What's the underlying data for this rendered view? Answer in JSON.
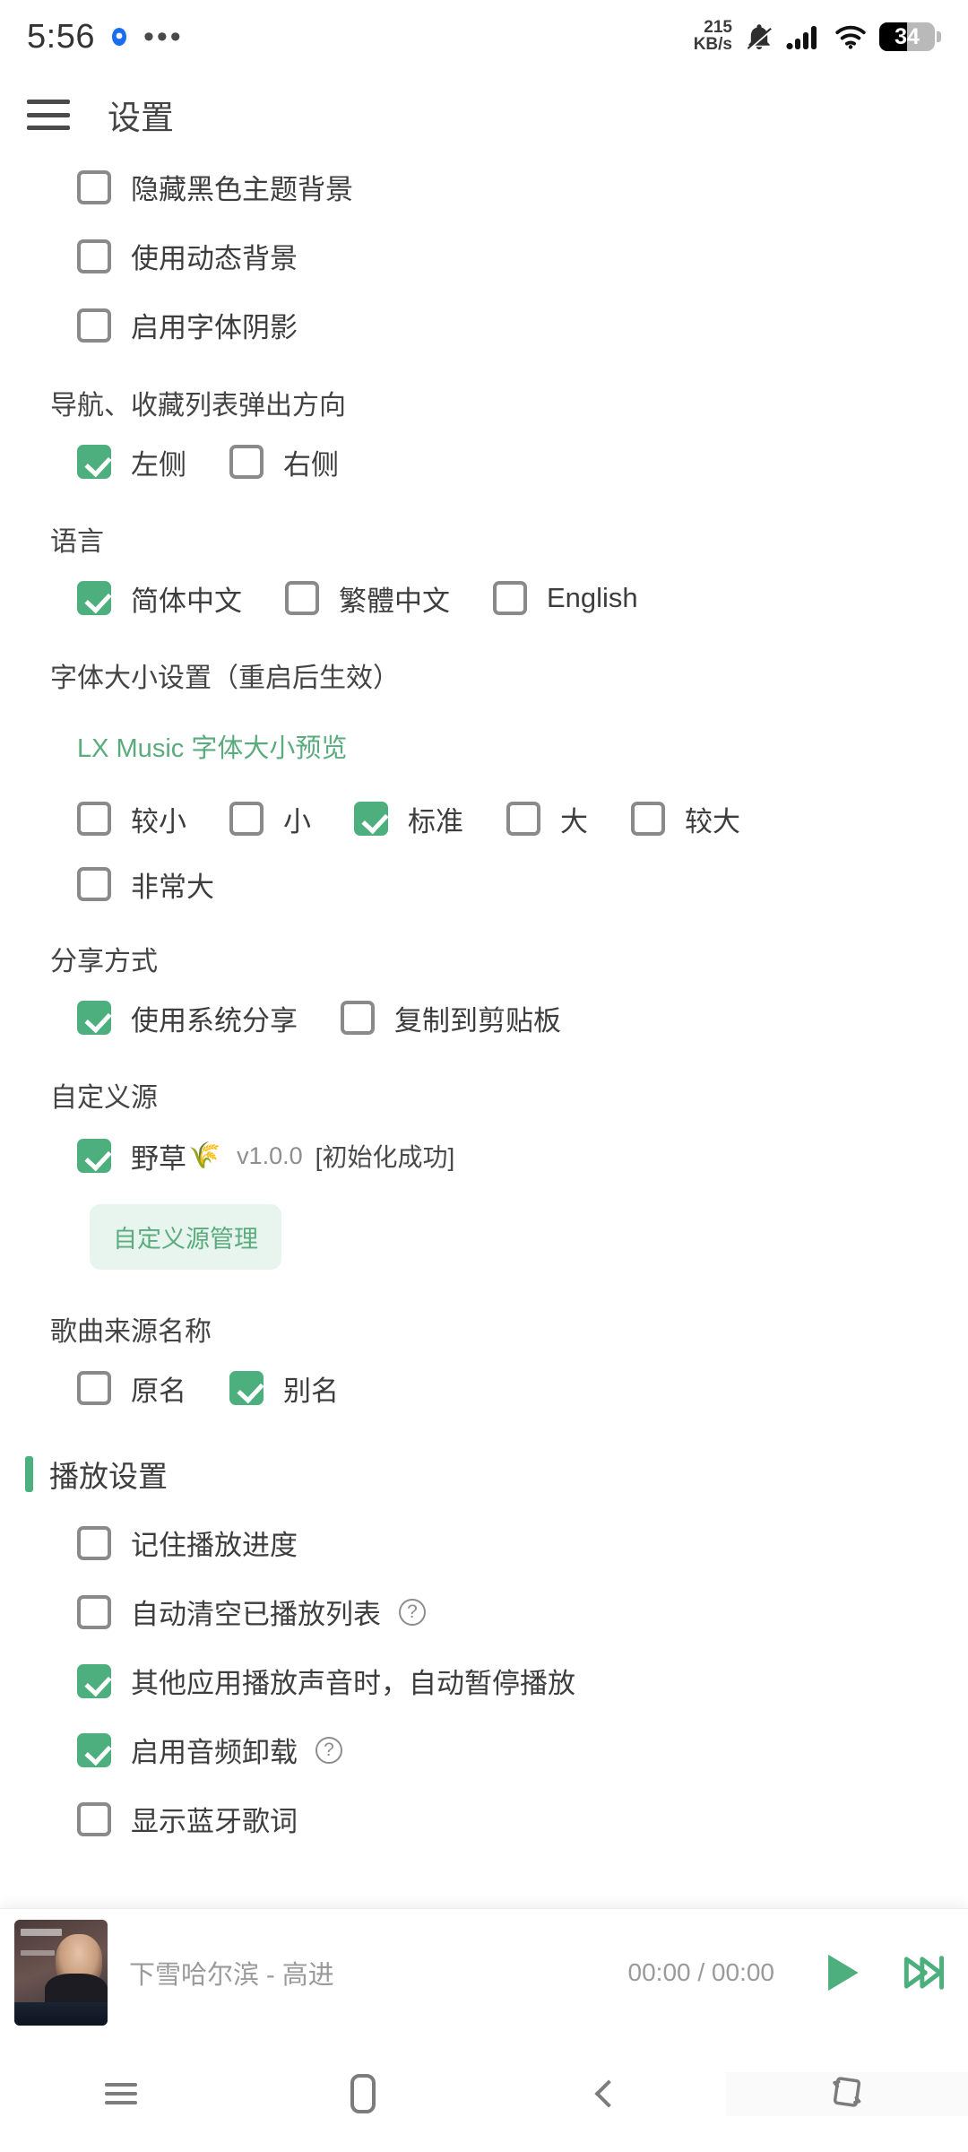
{
  "status_bar": {
    "time": "5:56",
    "badge_icon": "location-dot-icon",
    "overflow_icon": "more-ellipsis-icon",
    "net_speed_value": "215",
    "net_speed_unit": "KB/s",
    "mute_icon": "bell-muted-icon",
    "signal_icon": "cellular-signal-icon",
    "wifi_icon": "wifi-icon",
    "battery_percent": "34"
  },
  "header": {
    "menu_icon": "hamburger-menu-icon",
    "title": "设置"
  },
  "settings": {
    "theme_options": [
      {
        "label": "隐藏黑色主题背景",
        "checked": false
      },
      {
        "label": "使用动态背景",
        "checked": false
      },
      {
        "label": "启用字体阴影",
        "checked": false
      }
    ],
    "popup_direction": {
      "title": "导航、收藏列表弹出方向",
      "options": [
        {
          "label": "左侧",
          "checked": true
        },
        {
          "label": "右侧",
          "checked": false
        }
      ]
    },
    "language": {
      "title": "语言",
      "options": [
        {
          "label": "简体中文",
          "checked": true
        },
        {
          "label": "繁體中文",
          "checked": false
        },
        {
          "label": "English",
          "checked": false
        }
      ]
    },
    "font_size": {
      "title": "字体大小设置（重启后生效）",
      "preview": "LX Music 字体大小预览",
      "options": [
        {
          "label": "较小",
          "checked": false
        },
        {
          "label": "小",
          "checked": false
        },
        {
          "label": "标准",
          "checked": true
        },
        {
          "label": "大",
          "checked": false
        },
        {
          "label": "较大",
          "checked": false
        },
        {
          "label": "非常大",
          "checked": false
        }
      ]
    },
    "share": {
      "title": "分享方式",
      "options": [
        {
          "label": "使用系统分享",
          "checked": true
        },
        {
          "label": "复制到剪贴板",
          "checked": false
        }
      ]
    },
    "custom_source": {
      "title": "自定义源",
      "item_label": "野草",
      "item_emoji": "🌾",
      "item_version": "v1.0.0",
      "item_status": "[初始化成功]",
      "item_checked": true,
      "manage_button": "自定义源管理"
    },
    "source_name": {
      "title": "歌曲来源名称",
      "options": [
        {
          "label": "原名",
          "checked": false
        },
        {
          "label": "别名",
          "checked": true
        }
      ]
    },
    "playback": {
      "title": "播放设置",
      "options": [
        {
          "label": "记住播放进度",
          "checked": false,
          "help": false
        },
        {
          "label": "自动清空已播放列表",
          "checked": false,
          "help": true
        },
        {
          "label": "其他应用播放声音时，自动暂停播放",
          "checked": true,
          "help": false
        },
        {
          "label": "启用音频卸载",
          "checked": true,
          "help": true
        },
        {
          "label": "显示蓝牙歌词",
          "checked": false,
          "help": false
        }
      ]
    }
  },
  "player": {
    "song_title": "下雪哈尔滨 - 高进",
    "time_display": "00:00 / 00:00",
    "play_icon": "play-icon",
    "next_icon": "next-track-icon",
    "cover_icon": "album-cover"
  },
  "nav_bar": {
    "recents_icon": "recents-menu-icon",
    "home_icon": "home-icon",
    "back_icon": "back-chevron-icon",
    "rotate_icon": "rotate-screen-icon"
  },
  "colors": {
    "accent": "#4caf7d",
    "accent_light": "#e8f5ee",
    "text": "#3d3d3d",
    "muted": "#9a9a9a"
  }
}
